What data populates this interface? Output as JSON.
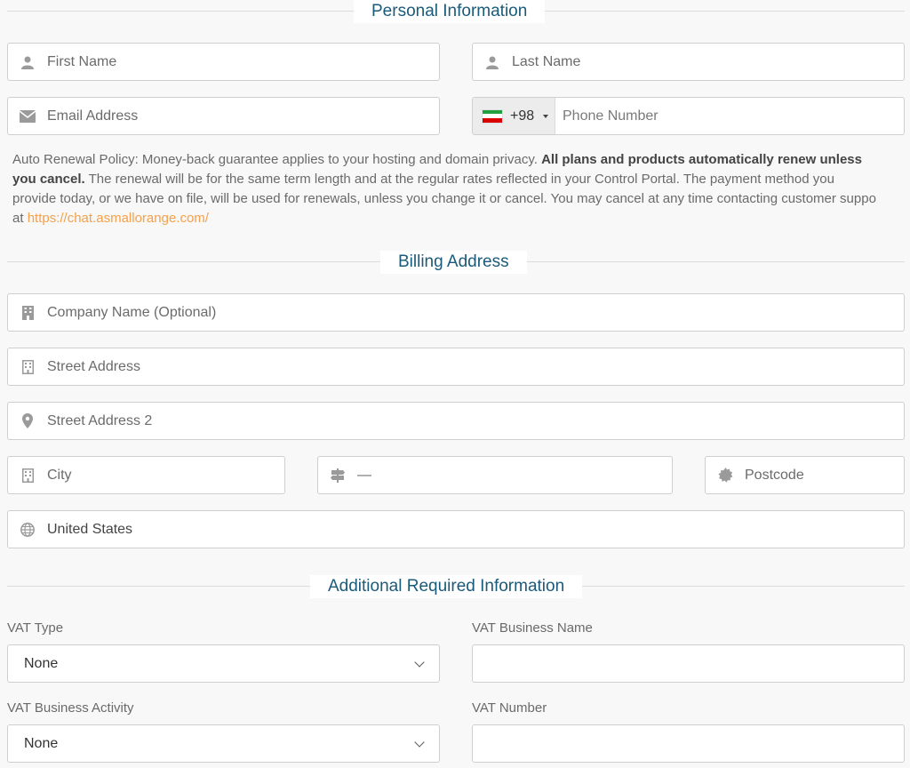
{
  "sections": {
    "personal": "Personal Information",
    "billing": "Billing Address",
    "additional": "Additional Required Information"
  },
  "personal": {
    "first_name": "First Name",
    "last_name": "Last Name",
    "email": "Email Address",
    "phone_code": "+98",
    "phone": "Phone Number"
  },
  "policy": {
    "intro": "Auto Renewal Policy: Money-back guarantee applies to your hosting and domain privacy. ",
    "bold1": "All plans and products automatically renew unless",
    "bold2": "you cancel.",
    "rest2": " The renewal will be for the same term length and at the regular rates reflected in your Control Portal. The payment method you",
    "line3": "provide today, or we have on file, will be used for renewals, unless you change it or cancel. You may cancel at any time contacting customer suppo",
    "at": "at ",
    "link": "https://chat.asmallorange.com/"
  },
  "billing": {
    "company": "Company Name (Optional)",
    "street": "Street Address",
    "street2": "Street Address 2",
    "city": "City",
    "state": "—",
    "postcode": "Postcode",
    "country": "United States"
  },
  "additional": {
    "vat_type_label": "VAT Type",
    "vat_type_value": "None",
    "vat_business_name_label": "VAT Business Name",
    "vat_activity_label": "VAT Business Activity",
    "vat_activity_value": "None",
    "vat_number_label": "VAT Number"
  },
  "icons": {
    "user": "user-icon",
    "envelope": "envelope-icon",
    "building": "building-icon",
    "map_marker": "map-marker-icon",
    "signpost": "signpost-icon",
    "badge": "certificate-icon",
    "globe": "globe-icon"
  },
  "colors": {
    "heading": "#1a5a7a",
    "link": "#f5a04a"
  }
}
